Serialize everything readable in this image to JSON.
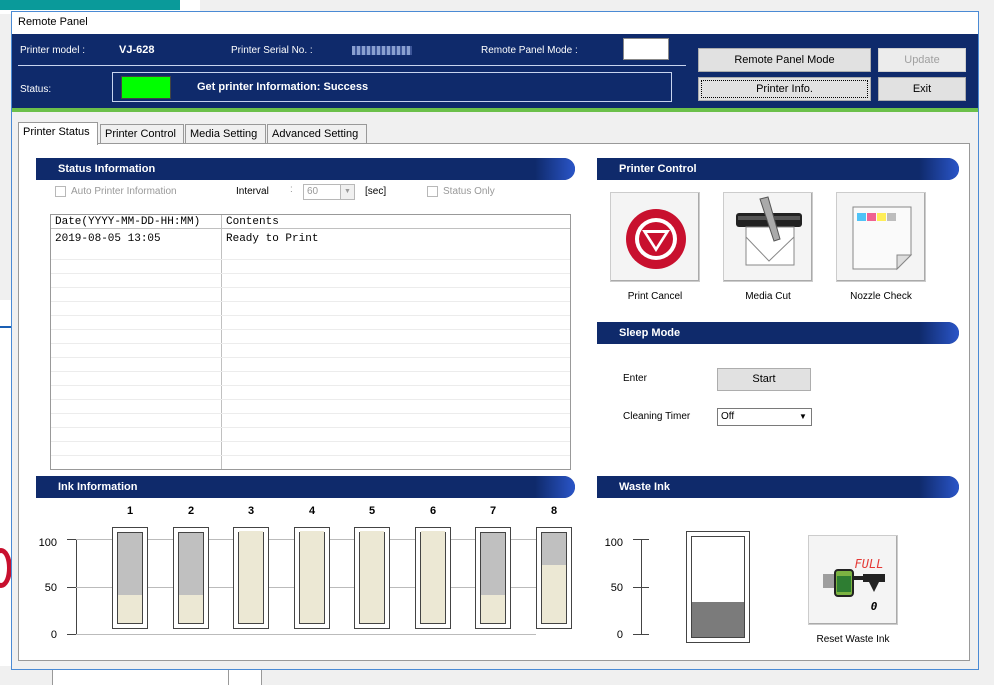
{
  "window": {
    "title": "Remote Panel"
  },
  "header": {
    "printer_model_label": "Printer model :",
    "printer_model_value": "VJ-628",
    "serial_label": "Printer Serial No. :",
    "mode_label": "Remote Panel Mode :",
    "status_label": "Status:",
    "status_message": "Get printer Information: Success",
    "status_color": "#00ff00",
    "buttons": {
      "remote_panel_mode": "Remote Panel Mode",
      "update": "Update",
      "printer_info": "Printer Info.",
      "exit": "Exit"
    }
  },
  "tabs": [
    "Printer Status",
    "Printer Control",
    "Media Setting",
    "Advanced Setting"
  ],
  "status_information": {
    "title": "Status Information",
    "auto_printer_info_label": "Auto Printer Information",
    "interval_label": "Interval",
    "interval_colon": ":",
    "interval_value": "60",
    "interval_unit": "[sec]",
    "status_only_label": "Status Only",
    "columns": [
      "Date(YYYY-MM-DD-HH:MM)",
      "Contents"
    ],
    "rows": [
      {
        "date": "2019-08-05 13:05",
        "contents": "Ready to Print"
      }
    ]
  },
  "printer_control": {
    "title": "Printer Control",
    "buttons": [
      "Print Cancel",
      "Media Cut",
      "Nozzle Check"
    ]
  },
  "sleep_mode": {
    "title": "Sleep Mode",
    "enter_label": "Enter",
    "start_button": "Start",
    "cleaning_timer_label": "Cleaning Timer",
    "cleaning_timer_value": "Off"
  },
  "ink_information": {
    "title": "Ink Information",
    "axis_labels": [
      "100",
      "50",
      "0"
    ],
    "tanks": [
      {
        "label": "1",
        "level": 30
      },
      {
        "label": "2",
        "level": 30
      },
      {
        "label": "3",
        "level": 100
      },
      {
        "label": "4",
        "level": 100
      },
      {
        "label": "5",
        "level": 100
      },
      {
        "label": "6",
        "level": 100
      },
      {
        "label": "7",
        "level": 30
      },
      {
        "label": "8",
        "level": 63
      }
    ],
    "fill_color": "#ece8d4",
    "empty_color": "#c0c0c0"
  },
  "waste_ink": {
    "title": "Waste Ink",
    "axis_labels": [
      "100",
      "50",
      "0"
    ],
    "level": 35,
    "reset_label": "Reset Waste Ink",
    "icon_full_text": "FULL",
    "icon_zero_text": "0"
  }
}
